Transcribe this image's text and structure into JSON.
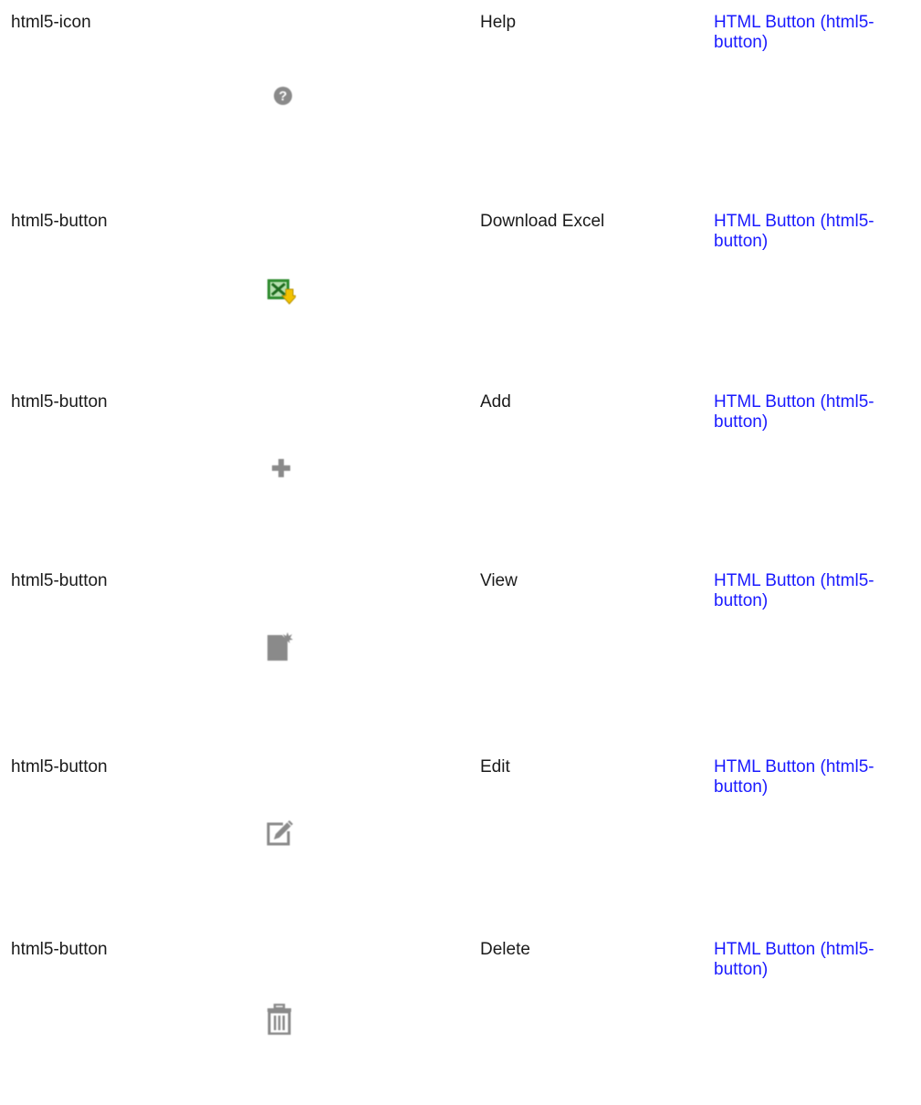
{
  "rows": [
    {
      "type": "html5-icon",
      "label": "Help",
      "link": "HTML Button (html5-button)",
      "icon": "help-icon"
    },
    {
      "type": "html5-button",
      "label": "Download Excel",
      "link": "HTML Button (html5-button)",
      "icon": "excel-download-icon"
    },
    {
      "type": "html5-button",
      "label": "Add",
      "link": "HTML Button (html5-button)",
      "icon": "plus-icon"
    },
    {
      "type": "html5-button",
      "label": "View",
      "link": "HTML Button (html5-button)",
      "icon": "new-document-icon"
    },
    {
      "type": "html5-button",
      "label": "Edit",
      "link": "HTML Button (html5-button)",
      "icon": "edit-icon"
    },
    {
      "type": "html5-button",
      "label": "Delete",
      "link": "HTML Button (html5-button)",
      "icon": "trash-icon"
    }
  ],
  "colors": {
    "link": "#1a1aff",
    "icon_gray": "#8a8a8a",
    "excel_green": "#2e8b2e",
    "download_yellow": "#f2c200"
  }
}
